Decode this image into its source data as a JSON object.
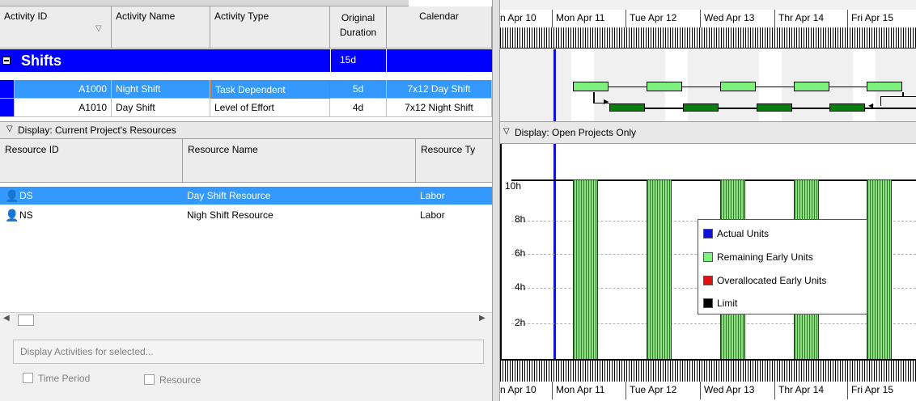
{
  "activity_table": {
    "headers": {
      "activity_id": "Activity ID",
      "activity_name": "Activity Name",
      "activity_type": "Activity Type",
      "original_duration": "Original\nDuration",
      "calendar": "Calendar"
    },
    "group": {
      "name": "Shifts",
      "duration": "15d"
    },
    "rows": [
      {
        "id": "A1000",
        "name": "Night Shift",
        "type": "Task Dependent",
        "duration": "5d",
        "calendar": "7x12 Day Shift"
      },
      {
        "id": "A1010",
        "name": "Day Shift",
        "type": "Level of Effort",
        "duration": "4d",
        "calendar": "7x12 Night Shift"
      }
    ]
  },
  "resources_panel": {
    "display_label": "Display: Current Project's Resources",
    "headers": {
      "resource_id": "Resource ID",
      "resource_name": "Resource Name",
      "resource_type": "Resource Ty"
    },
    "rows": [
      {
        "id": "DS",
        "name": "Day Shift Resource",
        "type": "Labor"
      },
      {
        "id": "NS",
        "name": "Nigh Shift Resource",
        "type": "Labor"
      }
    ],
    "display_activities": "Display Activities for selected...",
    "time_period": "Time Period",
    "resource": "Resource"
  },
  "gantt": {
    "dates": [
      "n Apr 10",
      "Mon Apr 11",
      "Tue Apr 12",
      "Wed Apr 13",
      "Thr Apr 14",
      "Fri Apr 15"
    ]
  },
  "histogram": {
    "display_label": "Display: Open Projects Only",
    "y_ticks": [
      "10h",
      "8h",
      "6h",
      "4h",
      "2h"
    ],
    "legend": [
      {
        "label": "Actual Units",
        "color": "#1010e0"
      },
      {
        "label": "Remaining Early Units",
        "color": "#7ef07e"
      },
      {
        "label": "Overallocated Early Units",
        "color": "#e01010"
      },
      {
        "label": "Limit",
        "color": "#000000"
      }
    ]
  },
  "colors": {
    "selection": "#3399ff",
    "group": "#0000ff",
    "data_date": "#1010e0"
  }
}
